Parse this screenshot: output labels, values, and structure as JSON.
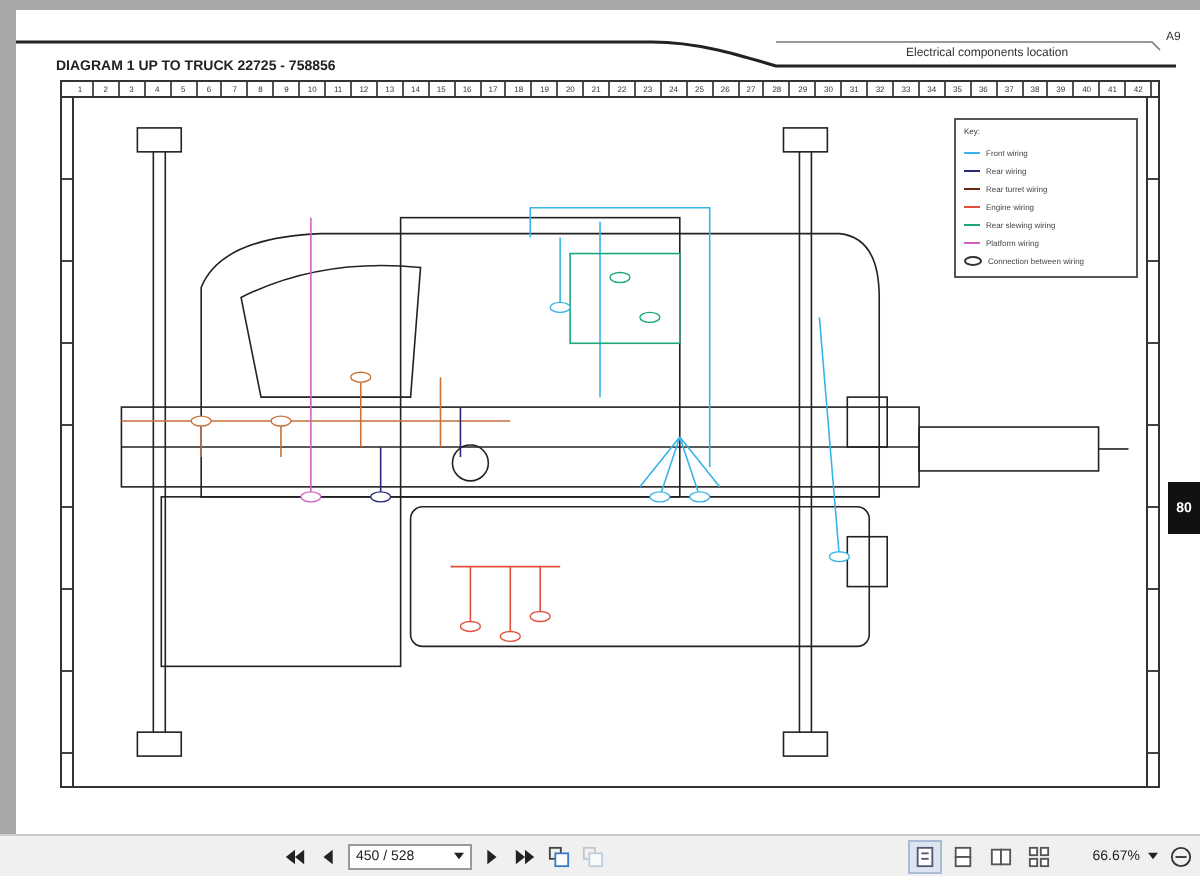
{
  "document": {
    "header_tab": "Electrical components location",
    "page_code": "A9",
    "title": "DIAGRAM 1 UP TO TRUCK 22725 - 758856",
    "side_tab": "80",
    "ruler_numbers": [
      "1",
      "2",
      "3",
      "4",
      "5",
      "6",
      "7",
      "8",
      "9",
      "10",
      "11",
      "12",
      "13",
      "14",
      "15",
      "16",
      "17",
      "18",
      "19",
      "20",
      "21",
      "22",
      "23",
      "24",
      "25",
      "26",
      "27",
      "28",
      "29",
      "30",
      "31",
      "32",
      "33",
      "34",
      "35",
      "36",
      "37",
      "38",
      "39",
      "40",
      "41",
      "42"
    ],
    "legend": {
      "title": "Key:",
      "items": [
        {
          "kind": "line",
          "label": "Front wiring",
          "color": "#3ab4e6"
        },
        {
          "kind": "line",
          "label": "Rear wiring",
          "color": "#2a2a7a"
        },
        {
          "kind": "line",
          "label": "Rear turret wiring",
          "color": "#6a2a10"
        },
        {
          "kind": "line",
          "label": "Engine wiring",
          "color": "#e0503a"
        },
        {
          "kind": "line",
          "label": "Rear slewing wiring",
          "color": "#1aa878"
        },
        {
          "kind": "line",
          "label": "Platform wiring",
          "color": "#d062c4"
        },
        {
          "kind": "oval",
          "label": "Connection between wiring"
        }
      ]
    }
  },
  "toolbar": {
    "page_field": {
      "value": "450 / 528"
    },
    "view_modes": [
      {
        "selected": true
      },
      {
        "selected": false
      },
      {
        "selected": false
      },
      {
        "selected": false
      }
    ],
    "zoom": "66.67%"
  }
}
